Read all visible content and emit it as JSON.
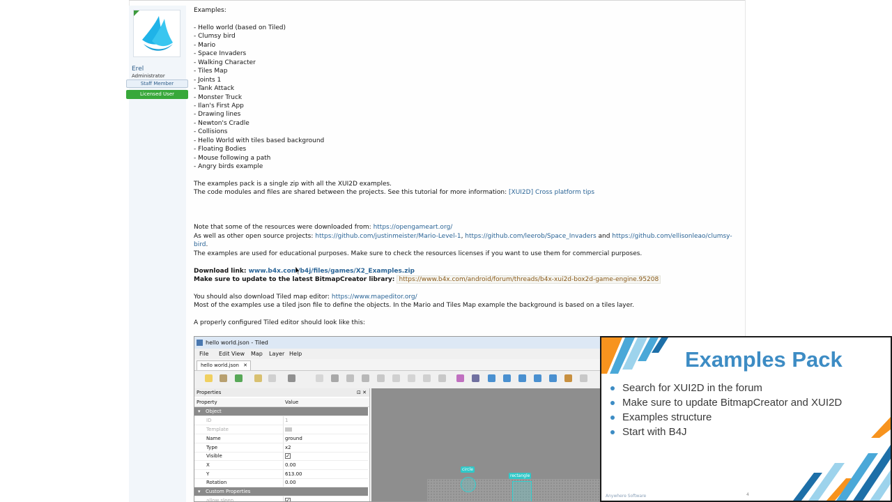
{
  "user": {
    "name": "Erel",
    "title": "Administrator",
    "badge_staff": "Staff Member",
    "badge_licensed": "Licensed User"
  },
  "post": {
    "intro": "Examples:",
    "examples": [
      "- Hello world (based on Tiled)",
      "- Clumsy bird",
      "- Mario",
      "- Space Invaders",
      "- Walking Character",
      "- Tiles Map",
      "- Joints 1",
      "- Tank Attack",
      "- Monster Truck",
      "- Ilan's First App",
      "- Drawing lines",
      "- Newton's Cradle",
      "- Collisions",
      "- Hello World with tiles based background",
      "- Floating Bodies",
      "- Mouse following a path",
      "- Angry birds example"
    ],
    "pack_line": "The examples pack is a single zip with all the XUI2D examples.",
    "modules_text": "The code modules and files are shared between the projects. See this tutorial for more information: ",
    "modules_link": "[XUI2D] Cross platform tips",
    "resources_text": "Note that some of the resources were downloaded from: ",
    "resources_link": "https://opengameart.org/",
    "open_source_text": "As well as other open source projects: ",
    "open_source_link1": "https://github.com/justinmeister/Mario-Level-1",
    "comma": ", ",
    "open_source_link2": "https://github.com/leerob/Space_Invaders",
    "and_text": " and ",
    "open_source_link3": "https://github.com/ellisonleao/clumsy-bird",
    "period": ".",
    "educational": "The examples are used for educational purposes. Make sure to check the resources licenses if you want to use them for commercial purposes.",
    "download_label": "Download link: ",
    "download_link": "www.b4x.com/b4j/files/games/X2_Examples.zip",
    "update_label": "Make sure to update to the latest BitmapCreator library: ",
    "update_link": "https://www.b4x.com/android/forum/threads/b4x-xui2d-box2d-game-engine.95208",
    "tiled_text": "You should also download Tiled map editor: ",
    "tiled_link": "https://www.mapeditor.org/",
    "tiled_json": "Most of the examples use a tiled json file to define the objects. In the Mario and Tiles Map example the background is based on a tiles layer.",
    "configured": "A properly configured Tiled editor should look like this:"
  },
  "tiled": {
    "window_title": "hello world.json - Tiled",
    "menu": [
      "File",
      "Edit",
      "View",
      "Map",
      "Layer",
      "Help"
    ],
    "tab": "hello world.json",
    "tab_close": "✕",
    "panel_title": "Properties",
    "panel_controls": "⊡ ✕",
    "col_property": "Property",
    "col_value": "Value",
    "group_object": "Object",
    "rows": [
      {
        "k": "ID",
        "v": "1"
      },
      {
        "k": "Template",
        "v": ""
      },
      {
        "k": "Name",
        "v": "ground"
      },
      {
        "k": "Type",
        "v": "x2"
      },
      {
        "k": "Visible",
        "v": "✓"
      },
      {
        "k": "X",
        "v": "0.00"
      },
      {
        "k": "Y",
        "v": "613.00"
      },
      {
        "k": "Rotation",
        "v": "0.00"
      }
    ],
    "group_custom": "Custom Properties",
    "custom_row": {
      "k": "allow sleep",
      "v": "✓"
    },
    "label_circle": "circle",
    "label_rectangle": "rectangle"
  },
  "slide": {
    "title": "Examples Pack",
    "bullets": [
      "Search for XUI2D in the forum",
      "Make sure to update BitmapCreator and XUI2D",
      "Examples structure",
      "Start with B4J"
    ],
    "footer": "Anywhere Software",
    "page": "4"
  }
}
